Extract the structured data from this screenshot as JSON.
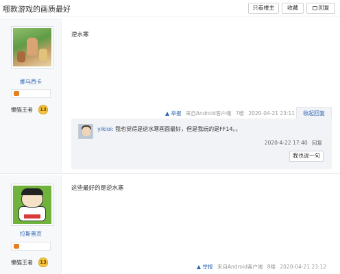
{
  "header": {
    "title": "哪款游戏的画质最好",
    "only_op_label": "只看楼主",
    "favorite_label": "收藏",
    "reply_label": "回复"
  },
  "posts": [
    {
      "author": "娜乌西卡",
      "level_name": "懒猫王者",
      "level_num": "13",
      "content": "逆水寒",
      "report_label": "举报",
      "source": "来自Android客户端",
      "floor": "7楼",
      "time": "2020-04-21 23:11",
      "collapse_label": "收起回复",
      "sub_reply": {
        "user": "yikioi:",
        "text": "我也觉得是逆水寒画面最好，但是我玩的是FF14。。",
        "time": "2020-4-22 17:40",
        "reply_label": "回复",
        "say_label": "我也说一句"
      }
    },
    {
      "author": "拉斯普京",
      "level_name": "懒猫王者",
      "level_num": "13",
      "content": "这些最好的是逆水寒",
      "report_label": "举报",
      "source": "来自Android客户端",
      "floor": "8楼",
      "time": "2020-04-21 23:12"
    }
  ]
}
